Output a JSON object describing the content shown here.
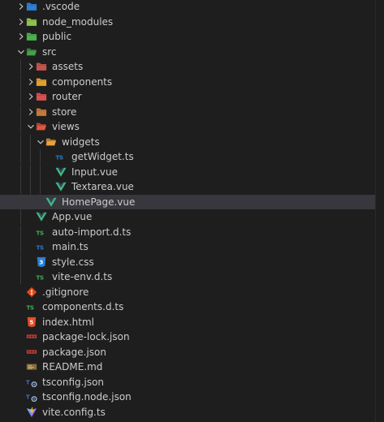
{
  "explorer": {
    "items": [
      {
        "label": ".vscode",
        "depth": 0,
        "kind": "folder",
        "expanded": false,
        "icon": "folder-vscode-icon",
        "color": "#2f7fd6",
        "selected": false
      },
      {
        "label": "node_modules",
        "depth": 0,
        "kind": "folder",
        "expanded": false,
        "icon": "folder-node-icon",
        "color": "#8bc34a",
        "selected": false
      },
      {
        "label": "public",
        "depth": 0,
        "kind": "folder",
        "expanded": false,
        "icon": "folder-public-icon",
        "color": "#4caf50",
        "selected": false
      },
      {
        "label": "src",
        "depth": 0,
        "kind": "folder",
        "expanded": true,
        "icon": "folder-src-icon",
        "color": "#43a047",
        "selected": false
      },
      {
        "label": "assets",
        "depth": 1,
        "kind": "folder",
        "expanded": false,
        "icon": "folder-assets-icon",
        "color": "#c0554e",
        "selected": false
      },
      {
        "label": "components",
        "depth": 1,
        "kind": "folder",
        "expanded": false,
        "icon": "folder-components-icon",
        "color": "#e0a030",
        "selected": false
      },
      {
        "label": "router",
        "depth": 1,
        "kind": "folder",
        "expanded": false,
        "icon": "folder-router-icon",
        "color": "#d35252",
        "selected": false
      },
      {
        "label": "store",
        "depth": 1,
        "kind": "folder",
        "expanded": false,
        "icon": "folder-store-icon",
        "color": "#c47a3a",
        "selected": false
      },
      {
        "label": "views",
        "depth": 1,
        "kind": "folder",
        "expanded": true,
        "icon": "folder-views-icon",
        "color": "#e0553f",
        "selected": false
      },
      {
        "label": "widgets",
        "depth": 2,
        "kind": "folder",
        "expanded": true,
        "icon": "folder-widgets-icon",
        "color": "#e6a23c",
        "selected": false
      },
      {
        "label": "getWidget.ts",
        "depth": 3,
        "kind": "file",
        "icon": "typescript-icon",
        "color": "#3178c6",
        "selected": false
      },
      {
        "label": "Input.vue",
        "depth": 3,
        "kind": "file",
        "icon": "vue-icon",
        "color": "#41b883",
        "selected": false
      },
      {
        "label": "Textarea.vue",
        "depth": 3,
        "kind": "file",
        "icon": "vue-icon",
        "color": "#41b883",
        "selected": false
      },
      {
        "label": "HomePage.vue",
        "depth": 2,
        "kind": "file",
        "icon": "vue-icon",
        "color": "#41b883",
        "selected": true
      },
      {
        "label": "App.vue",
        "depth": 1,
        "kind": "file",
        "icon": "vue-icon",
        "color": "#41b883",
        "selected": false
      },
      {
        "label": "auto-import.d.ts",
        "depth": 1,
        "kind": "file",
        "icon": "typescript-def-icon",
        "color": "#3fae5a",
        "selected": false
      },
      {
        "label": "main.ts",
        "depth": 1,
        "kind": "file",
        "icon": "typescript-icon",
        "color": "#3178c6",
        "selected": false
      },
      {
        "label": "style.css",
        "depth": 1,
        "kind": "file",
        "icon": "css-icon",
        "color": "#2a7fd4",
        "selected": false
      },
      {
        "label": "vite-env.d.ts",
        "depth": 1,
        "kind": "file",
        "icon": "typescript-def-icon",
        "color": "#3fae5a",
        "selected": false
      },
      {
        "label": ".gitignore",
        "depth": 0,
        "kind": "file",
        "icon": "git-icon",
        "color": "#e64a19",
        "selected": false
      },
      {
        "label": "components.d.ts",
        "depth": 0,
        "kind": "file",
        "icon": "typescript-def-icon",
        "color": "#3fae5a",
        "selected": false
      },
      {
        "label": "index.html",
        "depth": 0,
        "kind": "file",
        "icon": "html-icon",
        "color": "#e44d26",
        "selected": false
      },
      {
        "label": "package-lock.json",
        "depth": 0,
        "kind": "file",
        "icon": "npm-icon",
        "color": "#cb3837",
        "selected": false
      },
      {
        "label": "package.json",
        "depth": 0,
        "kind": "file",
        "icon": "npm-icon",
        "color": "#cb3837",
        "selected": false
      },
      {
        "label": "README.md",
        "depth": 0,
        "kind": "file",
        "icon": "readme-icon",
        "color": "#8a6d3b",
        "selected": false
      },
      {
        "label": "tsconfig.json",
        "depth": 0,
        "kind": "file",
        "icon": "tsconfig-icon",
        "color": "#3178c6",
        "selected": false
      },
      {
        "label": "tsconfig.node.json",
        "depth": 0,
        "kind": "file",
        "icon": "tsconfig-icon",
        "color": "#3178c6",
        "selected": false
      },
      {
        "label": "vite.config.ts",
        "depth": 0,
        "kind": "file",
        "icon": "vite-icon",
        "color": "#bd34fe",
        "selected": false
      }
    ]
  }
}
